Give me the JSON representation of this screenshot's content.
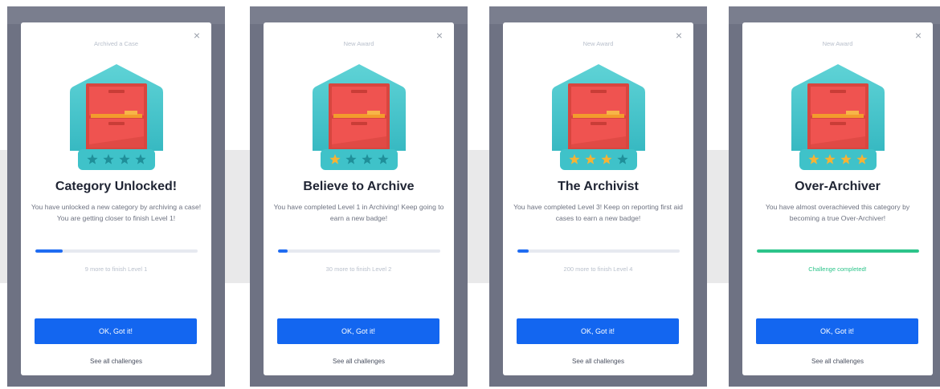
{
  "colors": {
    "primary_button": "#1366f0",
    "progress_fill": "#1f6cf2",
    "progress_complete": "#2cc48a",
    "badge_teal": "#4cc9cf",
    "cabinet_red": "#ef5350",
    "star_gold": "#f5b335",
    "star_teal": "#1f8f99"
  },
  "cards": [
    {
      "kicker": "Archived a Case",
      "close_icon": "×",
      "badge_icon": "filing-cabinet-icon",
      "stars_filled": 0,
      "stars_total": 4,
      "title": "Category Unlocked!",
      "description": "You have unlocked a new category by archiving a case! You are getting closer to finish Level 1!",
      "progress": 0.17,
      "status": "9 more to finish Level 1",
      "completed": false,
      "button": "OK, Got it!",
      "link": "See all challenges"
    },
    {
      "kicker": "New Award",
      "close_icon": "×",
      "badge_icon": "filing-cabinet-icon",
      "stars_filled": 1,
      "stars_total": 4,
      "title": "Believe to Archive",
      "description": "You have completed Level 1 in Archiving! Keep going to earn a new badge!",
      "progress": 0.06,
      "status": "30 more to finish Level 2",
      "completed": false,
      "button": "OK, Got it!",
      "link": "See all challenges"
    },
    {
      "kicker": "New Award",
      "close_icon": "×",
      "badge_icon": "filing-cabinet-icon",
      "stars_filled": 3,
      "stars_total": 4,
      "title": "The Archivist",
      "description": "You have completed Level 3! Keep on reporting first aid cases to earn a new badge!",
      "progress": 0.07,
      "status": "200 more to finish Level 4",
      "completed": false,
      "button": "OK, Got it!",
      "link": "See all challenges"
    },
    {
      "kicker": "New Award",
      "close_icon": "×",
      "badge_icon": "filing-cabinet-icon",
      "stars_filled": 4,
      "stars_total": 4,
      "title": "Over-Archiver",
      "description": "You have almost overachieved this category by becoming a true Over-Archiver!",
      "progress": 1.0,
      "status": "Challenge completed!",
      "completed": true,
      "button": "OK, Got it!",
      "link": "See all challenges"
    }
  ]
}
